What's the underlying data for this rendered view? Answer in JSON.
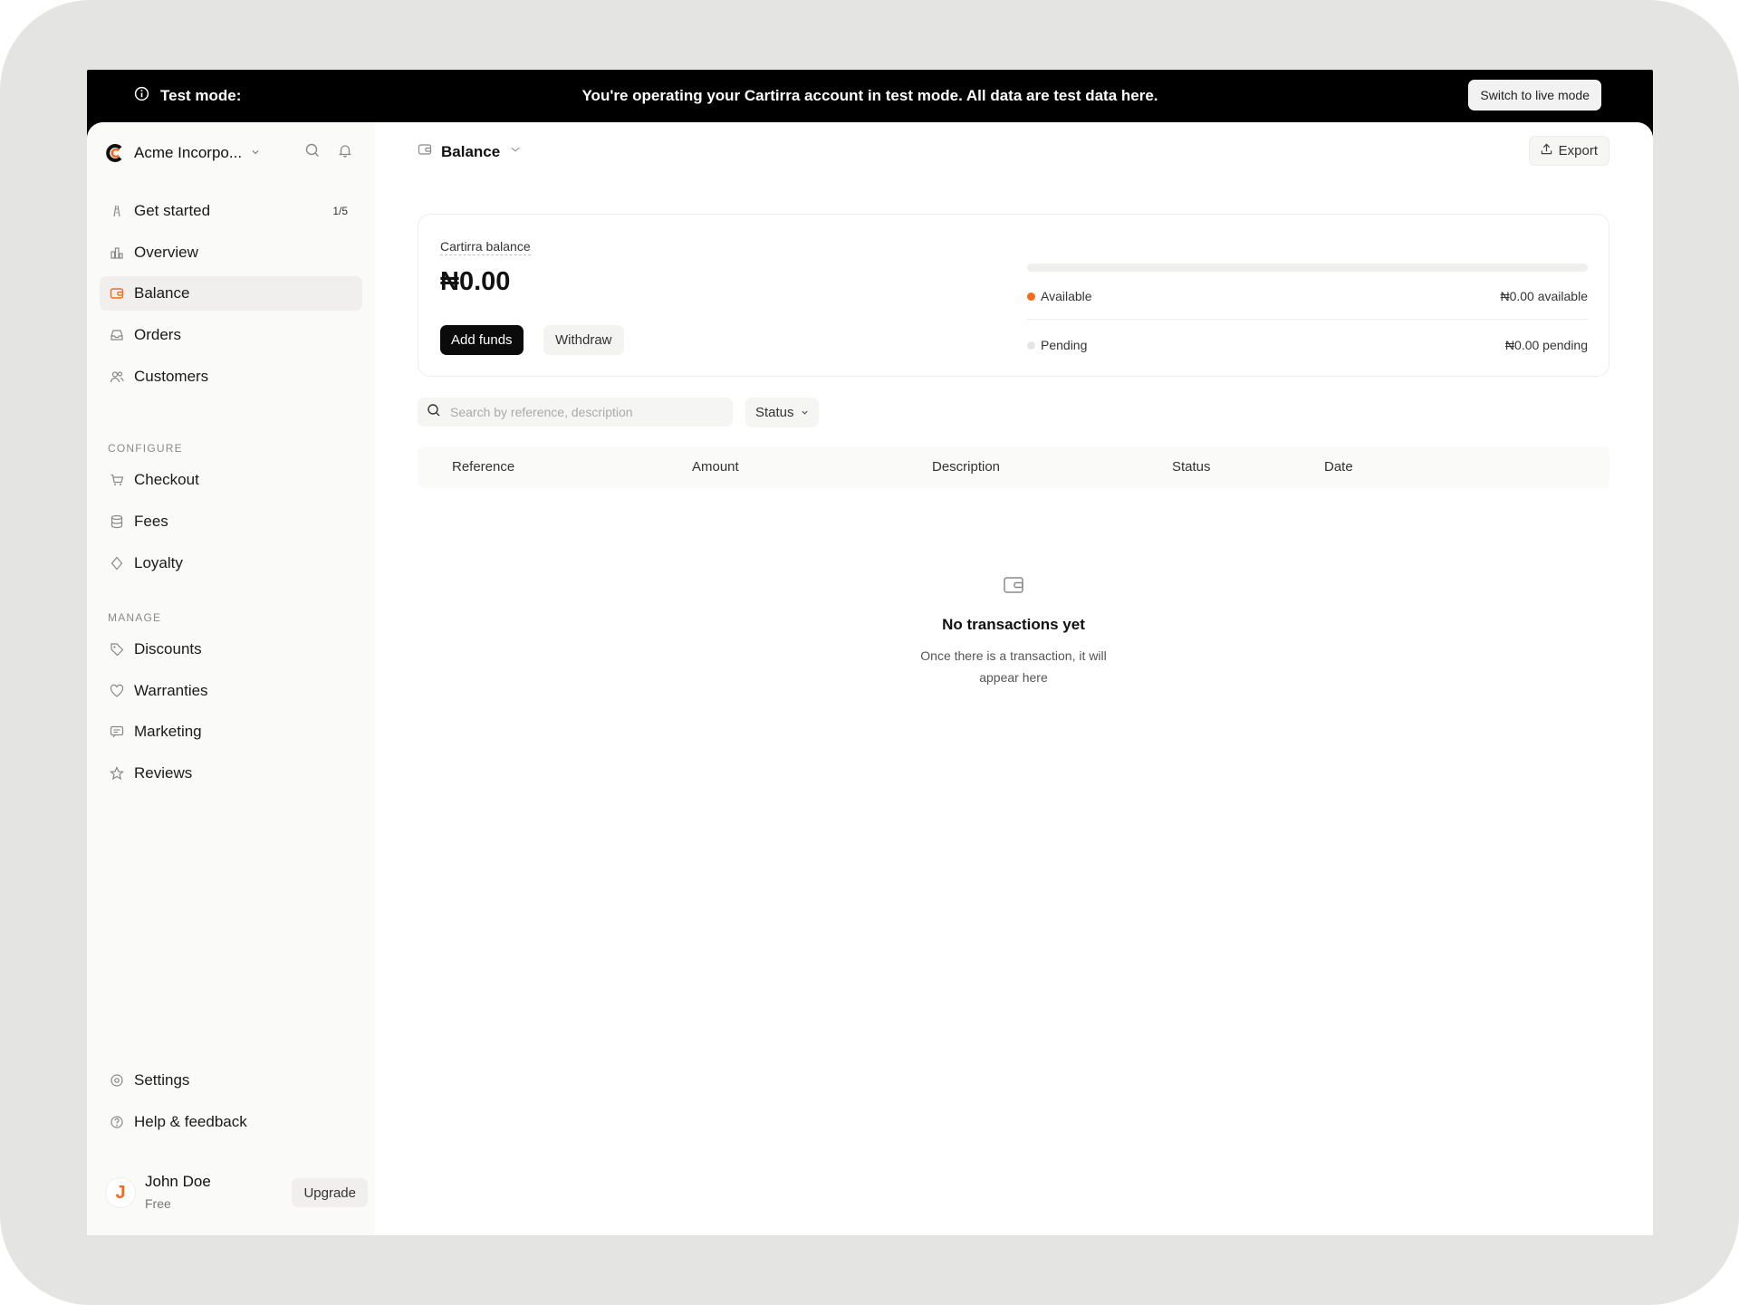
{
  "banner": {
    "label": "Test mode:",
    "message": "You're operating your Cartirra account in test mode. All data are test data here.",
    "switch_button": "Switch to live mode"
  },
  "sidebar": {
    "brand": "Acme Incorpo...",
    "items_top": [
      {
        "label": "Get started",
        "icon": "signpost-icon",
        "badge": "1/5"
      },
      {
        "label": "Overview",
        "icon": "bar-chart-icon"
      },
      {
        "label": "Balance",
        "icon": "wallet-icon",
        "active": true
      },
      {
        "label": "Orders",
        "icon": "inbox-icon"
      },
      {
        "label": "Customers",
        "icon": "users-icon"
      }
    ],
    "section_configure": "CONFIGURE",
    "items_configure": [
      {
        "label": "Checkout",
        "icon": "cart-icon"
      },
      {
        "label": "Fees",
        "icon": "database-icon"
      },
      {
        "label": "Loyalty",
        "icon": "diamond-icon"
      }
    ],
    "section_manage": "MANAGE",
    "items_manage": [
      {
        "label": "Discounts",
        "icon": "tag-icon"
      },
      {
        "label": "Warranties",
        "icon": "shield-heart-icon"
      },
      {
        "label": "Marketing",
        "icon": "message-icon"
      },
      {
        "label": "Reviews",
        "icon": "star-icon"
      }
    ],
    "items_bottom": [
      {
        "label": "Settings",
        "icon": "gear-icon"
      },
      {
        "label": "Help & feedback",
        "icon": "help-circle-icon"
      }
    ],
    "user": {
      "initial": "J",
      "name": "John Doe",
      "plan": "Free",
      "upgrade": "Upgrade"
    }
  },
  "header": {
    "title": "Balance",
    "export": "Export"
  },
  "balance_card": {
    "label": "Cartirra balance",
    "amount": "₦0.00",
    "add_funds": "Add funds",
    "withdraw": "Withdraw",
    "available_fraction": 0,
    "available": {
      "label": "Available",
      "value": "₦0.00 available",
      "color": "#f26b1d"
    },
    "pending": {
      "label": "Pending",
      "value": "₦0.00 pending",
      "color": "#e4e4e2"
    }
  },
  "filters": {
    "search_placeholder": "Search by reference, description",
    "status": "Status"
  },
  "table": {
    "columns": [
      "Reference",
      "Amount",
      "Description",
      "Status",
      "Date"
    ],
    "rows": []
  },
  "empty_state": {
    "title": "No transactions yet",
    "message": "Once there is a transaction, it will appear here"
  },
  "colors": {
    "accent": "#f26b1d",
    "banner_bg": "#000000",
    "sidebar_bg": "#fafaf9"
  }
}
